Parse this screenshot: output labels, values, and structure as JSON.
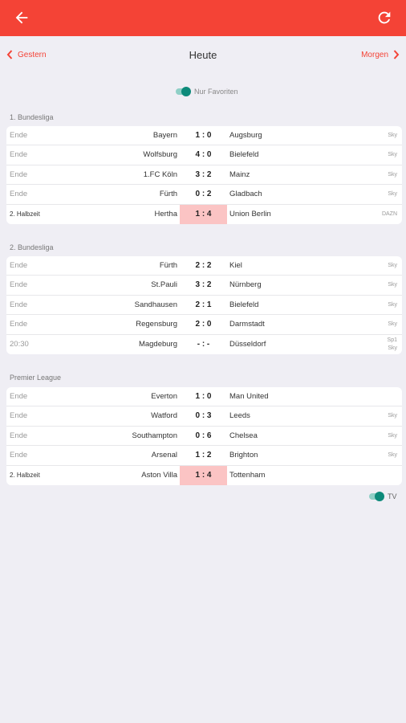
{
  "nav": {
    "prev_label": "Gestern",
    "title": "Heute",
    "next_label": "Morgen"
  },
  "favorites": {
    "label": "Nur Favoriten",
    "on": true
  },
  "tv_toggle": {
    "label": "TV",
    "on": true
  },
  "colors": {
    "accent": "#f44336",
    "live_score": "#fbc4c4",
    "toggle": "#0d8a7a",
    "background": "#efeef4"
  },
  "leagues": [
    {
      "name": "1. Bundesliga",
      "matches": [
        {
          "status": "Ende",
          "home": "Bayern",
          "score": "1 : 0",
          "away": "Augsburg",
          "tv": "Sky"
        },
        {
          "status": "Ende",
          "home": "Wolfsburg",
          "score": "4 : 0",
          "away": "Bielefeld",
          "tv": "Sky"
        },
        {
          "status": "Ende",
          "home": "1.FC Köln",
          "score": "3 : 2",
          "away": "Mainz",
          "tv": "Sky"
        },
        {
          "status": "Ende",
          "home": "Fürth",
          "score": "0 : 2",
          "away": "Gladbach",
          "tv": "Sky"
        },
        {
          "status": "2. Halbzeit",
          "home": "Hertha",
          "score": "1 : 4",
          "away": "Union Berlin",
          "tv": "DAZN"
        }
      ]
    },
    {
      "name": "2. Bundesliga",
      "matches": [
        {
          "status": "Ende",
          "home": "Fürth",
          "score": "2 : 2",
          "away": "Kiel",
          "tv": "Sky"
        },
        {
          "status": "Ende",
          "home": "St.Pauli",
          "score": "3 : 2",
          "away": "Nürnberg",
          "tv": "Sky"
        },
        {
          "status": "Ende",
          "home": "Sandhausen",
          "score": "2 : 1",
          "away": "Bielefeld",
          "tv": "Sky"
        },
        {
          "status": "Ende",
          "home": "Regensburg",
          "score": "2 : 0",
          "away": "Darmstadt",
          "tv": "Sky"
        },
        {
          "status": "20:30",
          "home": "Magdeburg",
          "score": "- : -",
          "away": "Düsseldorf",
          "tv_line1": "Sp1",
          "tv_line2": "Sky"
        }
      ]
    },
    {
      "name": "Premier League",
      "matches": [
        {
          "status": "Ende",
          "home": "Everton",
          "score": "1 : 0",
          "away": "Man United",
          "tv": ""
        },
        {
          "status": "Ende",
          "home": "Watford",
          "score": "0 : 3",
          "away": "Leeds",
          "tv": "Sky"
        },
        {
          "status": "Ende",
          "home": "Southampton",
          "score": "0 : 6",
          "away": "Chelsea",
          "tv": "Sky"
        },
        {
          "status": "Ende",
          "home": "Arsenal",
          "score": "1 : 2",
          "away": "Brighton",
          "tv": "Sky"
        },
        {
          "status": "2. Halbzeit",
          "home": "Aston Villa",
          "score": "1 : 4",
          "away": "Tottenham",
          "tv": ""
        }
      ]
    }
  ]
}
